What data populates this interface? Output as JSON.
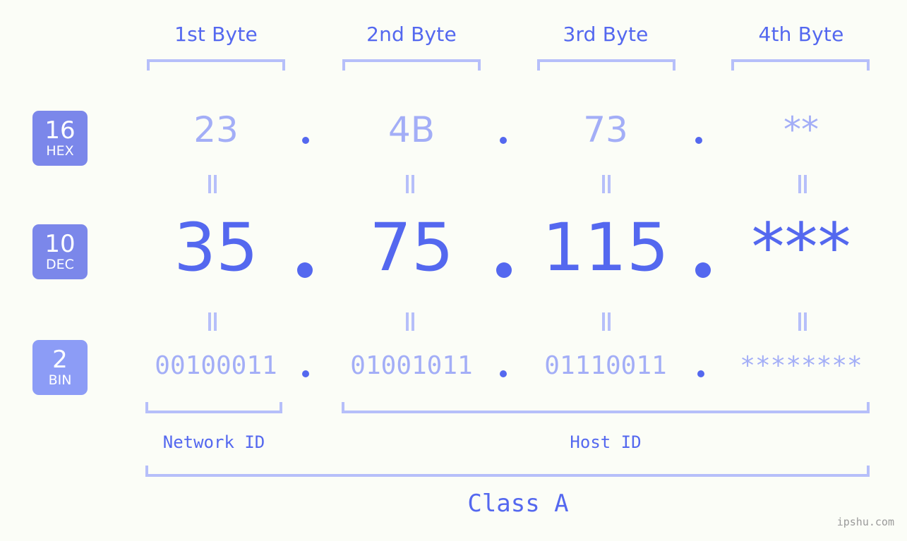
{
  "theme": {
    "background": "#fbfdf7",
    "accent_strong": "#5468ef",
    "accent_light": "#a3aef7",
    "bracket": "#b6bffa",
    "badge_hex": "#7b87ea",
    "badge_dec": "#7b87ea",
    "badge_bin": "#8c9cf6",
    "watermark_color": "#9a9a9a"
  },
  "header": {
    "bytes": [
      {
        "label": "1st Byte"
      },
      {
        "label": "2nd Byte"
      },
      {
        "label": "3rd Byte"
      },
      {
        "label": "4th Byte"
      }
    ]
  },
  "bases": [
    {
      "number": "16",
      "name": "HEX"
    },
    {
      "number": "10",
      "name": "DEC"
    },
    {
      "number": "2",
      "name": "BIN"
    }
  ],
  "rows": {
    "hex": {
      "values": [
        "23",
        "4B",
        "73",
        "**"
      ],
      "separator": "."
    },
    "dec": {
      "values": [
        "35",
        "75",
        "115",
        "***"
      ],
      "separator": "."
    },
    "bin": {
      "values": [
        "00100011",
        "01001011",
        "01110011",
        "********"
      ],
      "separator": "."
    }
  },
  "equals_marks": {
    "glyph": "||",
    "count_per_gap": 4
  },
  "footer": {
    "network_id_label": "Network ID",
    "host_id_label": "Host ID",
    "class_label": "Class A"
  },
  "watermark": {
    "text": "ipshu.com"
  }
}
